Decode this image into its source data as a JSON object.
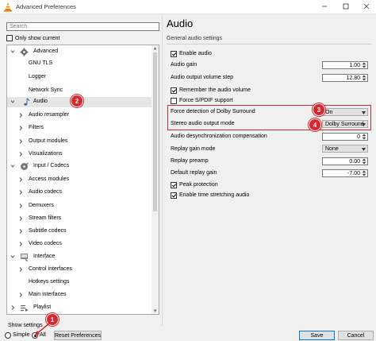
{
  "window": {
    "title": "Advanced Preferences"
  },
  "search": {
    "placeholder": "Search"
  },
  "only_show_current": {
    "label": "Only show current",
    "checked": false
  },
  "tree": {
    "items": [
      {
        "label": "Advanced",
        "level": 0,
        "icon": "gear-icon",
        "expanded": true
      },
      {
        "label": "GNU TLS",
        "level": 1
      },
      {
        "label": "Logger",
        "level": 1
      },
      {
        "label": "Network Sync",
        "level": 1
      },
      {
        "label": "Audio",
        "level": 0,
        "icon": "music-note-icon",
        "expanded": true,
        "selected": true
      },
      {
        "label": "Audio resampler",
        "level": 1,
        "has_children": true
      },
      {
        "label": "Filters",
        "level": 1,
        "has_children": true
      },
      {
        "label": "Output modules",
        "level": 1,
        "has_children": true
      },
      {
        "label": "Visualizations",
        "level": 1,
        "has_children": true
      },
      {
        "label": "Input / Codecs",
        "level": 0,
        "icon": "disc-icon",
        "expanded": true
      },
      {
        "label": "Access modules",
        "level": 1,
        "has_children": true
      },
      {
        "label": "Audio codecs",
        "level": 1,
        "has_children": true
      },
      {
        "label": "Demuxers",
        "level": 1,
        "has_children": true
      },
      {
        "label": "Stream filters",
        "level": 1,
        "has_children": true
      },
      {
        "label": "Subtitle codecs",
        "level": 1,
        "has_children": true
      },
      {
        "label": "Video codecs",
        "level": 1,
        "has_children": true
      },
      {
        "label": "Interface",
        "level": 0,
        "icon": "interface-icon",
        "expanded": true
      },
      {
        "label": "Control interfaces",
        "level": 1,
        "has_children": true
      },
      {
        "label": "Hotkeys settings",
        "level": 1
      },
      {
        "label": "Main interfaces",
        "level": 1,
        "has_children": true
      },
      {
        "label": "Playlist",
        "level": 0,
        "icon": "playlist-icon",
        "expanded": false
      }
    ]
  },
  "show_settings": {
    "label": "Show settings",
    "simple_label": "Simple",
    "all_label": "All",
    "selected": "All"
  },
  "buttons": {
    "reset": "Reset Preferences",
    "save": "Save",
    "cancel": "Cancel"
  },
  "panel": {
    "title": "Audio",
    "subtitle": "General audio settings",
    "enable_audio": {
      "label": "Enable audio",
      "checked": true
    },
    "audio_gain": {
      "label": "Audio gain",
      "value": "1.00"
    },
    "volume_step": {
      "label": "Audio output volume step",
      "value": "12.80"
    },
    "remember_volume": {
      "label": "Remember the audio volume",
      "checked": true
    },
    "force_spdif": {
      "label": "Force S/PDIF support",
      "checked": false
    },
    "dolby_detection": {
      "label": "Force detection of Dolby Surround",
      "value": "On"
    },
    "stereo_mode": {
      "label": "Stereo audio output mode",
      "value": "Dolby Surround"
    },
    "desync_comp": {
      "label": "Audio desynchronization compensation",
      "value": "0"
    },
    "replay_gain_mode": {
      "label": "Replay gain mode",
      "value": "None"
    },
    "replay_preamp": {
      "label": "Replay preamp",
      "value": "0.00"
    },
    "default_replay_gain": {
      "label": "Default replay gain",
      "value": "-7.00"
    },
    "peak_protection": {
      "label": "Peak protection",
      "checked": true
    },
    "time_stretching": {
      "label": "Enable time stretching audio",
      "checked": true
    }
  },
  "annotations": {
    "badge1": "1",
    "badge2": "2",
    "badge3": "3",
    "badge4": "4"
  },
  "colors": {
    "annotation_red": "#d7282f",
    "selection_gray": "#e5e5e5"
  }
}
